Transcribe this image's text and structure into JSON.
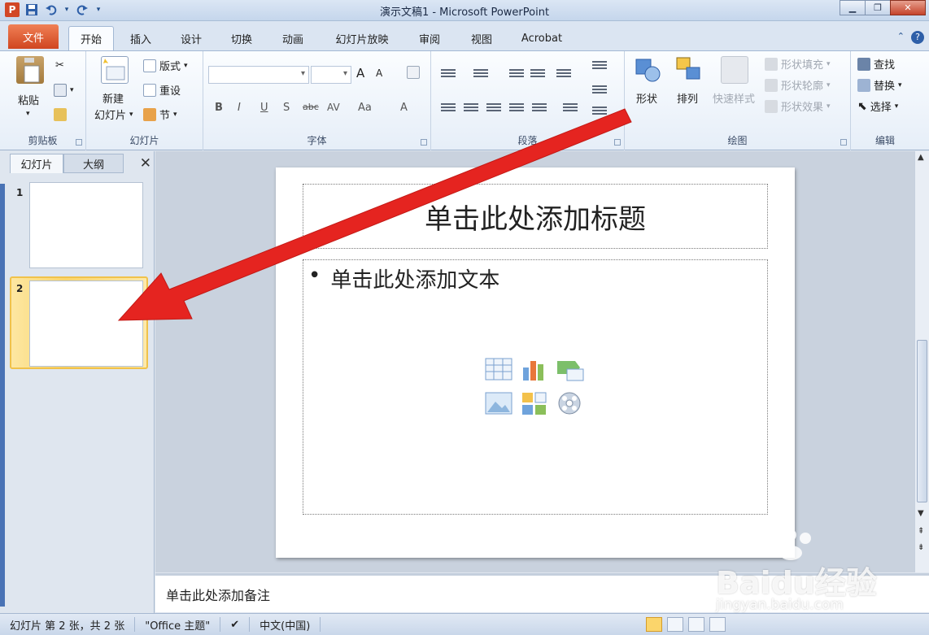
{
  "window": {
    "title": "演示文稿1 - Microsoft PowerPoint",
    "app_icon_letter": "P"
  },
  "tabs": [
    {
      "label": "文件"
    },
    {
      "label": "开始"
    },
    {
      "label": "插入"
    },
    {
      "label": "设计"
    },
    {
      "label": "切换"
    },
    {
      "label": "动画"
    },
    {
      "label": "幻灯片放映"
    },
    {
      "label": "审阅"
    },
    {
      "label": "视图"
    },
    {
      "label": "Acrobat"
    }
  ],
  "ribbon": {
    "clipboard": {
      "paste": "粘贴",
      "label": "剪贴板"
    },
    "slides": {
      "new_slide_1": "新建",
      "new_slide_2": "幻灯片",
      "layout": "版式",
      "reset": "重设",
      "section": "节",
      "label": "幻灯片"
    },
    "font": {
      "label": "字体",
      "bold": "B",
      "italic": "I",
      "underline": "U",
      "shadow": "S",
      "strike": "abc",
      "spacing": "AV",
      "case": "Aa",
      "color": "A",
      "grow": "A",
      "shrink": "A"
    },
    "paragraph": {
      "label": "段落"
    },
    "drawing": {
      "shapes": "形状",
      "arrange": "排列",
      "quick_styles": "快速样式",
      "fill": "形状填充",
      "outline": "形状轮廓",
      "effects": "形状效果",
      "label": "绘图"
    },
    "editing": {
      "find": "查找",
      "replace": "替换",
      "select": "选择",
      "label": "编辑"
    }
  },
  "left_pane": {
    "tab_slides": "幻灯片",
    "tab_outline": "大纲",
    "close": "✕",
    "slides": [
      {
        "num": "1"
      },
      {
        "num": "2"
      }
    ]
  },
  "slide": {
    "title_placeholder": "单击此处添加标题",
    "bullet": "•",
    "body_placeholder": "单击此处添加文本"
  },
  "notes": {
    "placeholder": "单击此处添加备注"
  },
  "status": {
    "slide_info": "幻灯片 第 2 张，共 2 张",
    "theme": "\"Office 主题\"",
    "language": "中文(中国)"
  },
  "watermark": {
    "text": "Baidu经验",
    "sub": "jingyan.baidu.com"
  },
  "colors": {
    "accent": "#d24726",
    "selection": "#fbd56b",
    "arrow": "#e52420"
  }
}
